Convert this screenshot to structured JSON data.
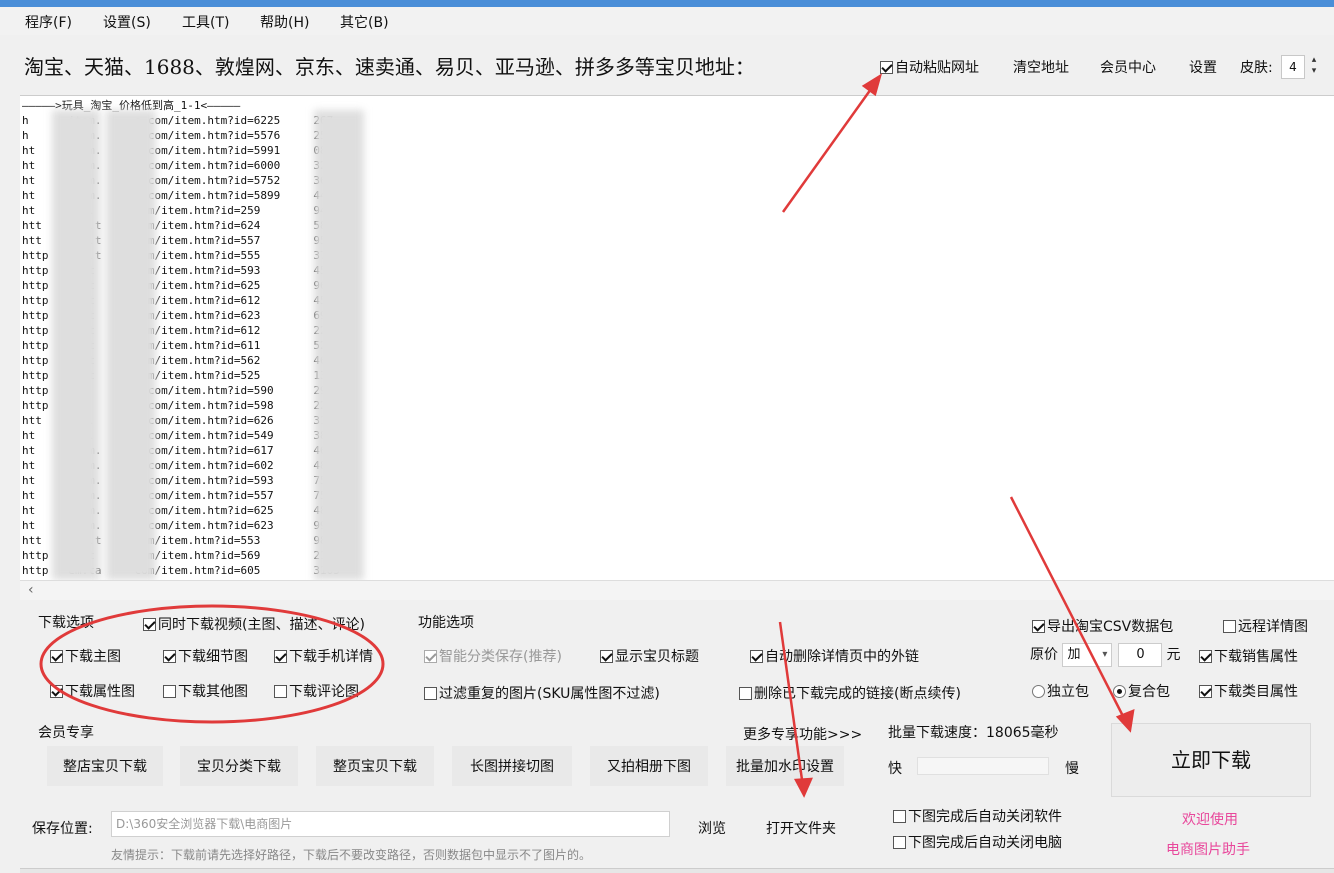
{
  "menu": [
    "程序(F)",
    "设置(S)",
    "工具(T)",
    "帮助(H)",
    "其它(B)"
  ],
  "toolbar": {
    "url_label": "淘宝、天猫、1688、敦煌网、京东、速卖通、易贝、亚马逊、拼多多等宝贝地址：",
    "auto_paste": "自动粘贴网址",
    "auto_paste_checked": true,
    "clear": "清空地址",
    "member_center": "会员中心",
    "settings": "设置",
    "skin_label": "皮肤:",
    "skin_value": "4"
  },
  "url_list": {
    "header": "—————>玩具_淘宝_价格低到高_1-1<—————",
    "lines": [
      "h      item.     o.com/item.htm?id=6225     267",
      "h      item.     o.com/item.htm?id=5576     258",
      "ht     item.     o.com/item.htm?id=5991     0850",
      "ht     item.     o.com/item.htm?id=6000     3216",
      "ht     item.     o.com/item.htm?id=5752     3658",
      "ht     item.     o.com/item.htm?id=5899     4487",
      "ht     tem.      com/item.htm?id=259        940",
      "htt    tem.t     com/item.htm?id=624        5867",
      "htt    tem.t     com/item.htm?id=557        9590",
      "http   tem.t     com/item.htm?id=555        3746",
      "http   em.t      com/item.htm?id=593        4577",
      "http   em.t      com/item.htm?id=625        9649",
      "http   em.t      com/item.htm?id=612        4509",
      "http   em.t      com/item.htm?id=623        6961",
      "http   em.t      com/item.htm?id=612        2245",
      "http   em.t      com/item.htm?id=611        5231",
      "http   em.t      com/item.htm?id=562        4636",
      "http   em.t      com/item.htm?id=525        1307",
      "http   em.       o.com/item.htm?id=590      2919",
      "http   em.       o.com/item.htm?id=598      2201",
      "htt    tem.      o.com/item.htm?id=626      3126",
      "ht     tem.      o.com/item.htm?id=549      3892",
      "ht     item.     o.com/item.htm?id=617      4624",
      "ht     item.     o.com/item.htm?id=602      4820",
      "ht     item.     o.com/item.htm?id=593      7534",
      "ht     item.     o.com/item.htm?id=557      7536",
      "ht     item.     o.com/item.htm?id=625      4883",
      "ht     item.     o.com/item.htm?id=623      9905",
      "htt    tem.t     com/item.htm?id=553        9895",
      "http   em.t      com/item.htm?id=569        2182",
      "http   em.ta     com/item.htm?id=605        3105"
    ]
  },
  "download_options": {
    "title": "下载选项",
    "video": "同时下载视频(主图、描述、评论)",
    "main_img": "下载主图",
    "detail_img": "下载细节图",
    "mobile_detail": "下载手机详情",
    "attr_img": "下载属性图",
    "other_img": "下载其他图",
    "review_img": "下载评论图"
  },
  "func_options": {
    "title": "功能选项",
    "smart_sort": "智能分类保存(推荐)",
    "show_title": "显示宝贝标题",
    "auto_delete": "自动删除详情页中的外链",
    "filter_dup": "过滤重复的图片(SKU属性图不过滤)",
    "delete_done": "删除已下载完成的链接(断点续传)"
  },
  "right_options": {
    "export_csv": "导出淘宝CSV数据包",
    "remote_detail": "远程详情图",
    "price_label": "原价",
    "price_op": "加",
    "price_value": "0",
    "price_unit": "元",
    "sales_attr": "下载销售属性",
    "single_pkg": "独立包",
    "combo_pkg": "复合包",
    "category_attr": "下载类目属性"
  },
  "member": {
    "title": "会员专享",
    "more": "更多专享功能>>>",
    "speed_label": "批量下载速度：18065毫秒",
    "buttons": [
      "整店宝贝下载",
      "宝贝分类下载",
      "整页宝贝下载",
      "长图拼接切图",
      "又拍相册下图",
      "批量加水印设置"
    ],
    "fast": "快",
    "slow": "慢",
    "download_now": "立即下载"
  },
  "save": {
    "label": "保存位置:",
    "path": "D:\\360安全浏览器下载\\电商图片",
    "browse": "浏览",
    "open_folder": "打开文件夹",
    "hint": "友情提示：下载前请先选择好路径，下载后不要改变路径，否则数据包中显示不了图片的。",
    "close_app": "下图完成后自动关闭软件",
    "shutdown": "下图完成后自动关闭电脑"
  },
  "welcome": {
    "line1": "欢迎使用",
    "line2": "电商图片助手"
  },
  "colors": {
    "annotation": "#e03a3a",
    "welcome": "#e8479b",
    "titlebar": "#4a8ed8"
  }
}
